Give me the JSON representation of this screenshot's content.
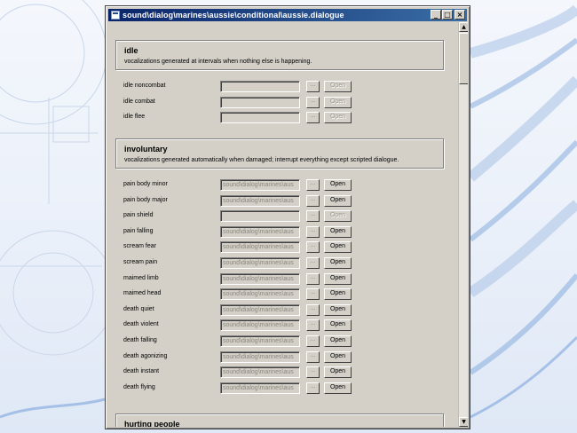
{
  "window": {
    "title": "sound\\dialog\\marines\\aussie\\conditional\\aussie.dialogue",
    "minimize_glyph": "_",
    "maximize_glyph": "□",
    "close_glyph": "×"
  },
  "icons": {
    "system": "window-app-icon",
    "browse": "ellipsis-icon",
    "scroll_up": "up-arrow-icon",
    "scroll_down": "down-arrow-icon"
  },
  "scrollbar": {
    "up_glyph": "▲",
    "down_glyph": "▼"
  },
  "browse_label": "...",
  "open_label": "Open",
  "sections": [
    {
      "title": "idle",
      "description": "vocalizations generated at intervals when nothing else is happening.",
      "rows": [
        {
          "label": "idle noncombat",
          "value": "",
          "open_enabled": false
        },
        {
          "label": "idle combat",
          "value": "",
          "open_enabled": false
        },
        {
          "label": "idle flee",
          "value": "",
          "open_enabled": false
        }
      ]
    },
    {
      "title": "involuntary",
      "description": "vocalizations generated automatically when damaged; interrupt everything except scripted dialogue.",
      "rows": [
        {
          "label": "pain body minor",
          "value": "sound\\dialog\\marines\\aus",
          "open_enabled": true
        },
        {
          "label": "pain body major",
          "value": "sound\\dialog\\marines\\aus",
          "open_enabled": true
        },
        {
          "label": "pain shield",
          "value": "",
          "open_enabled": false
        },
        {
          "label": "pain falling",
          "value": "sound\\dialog\\marines\\aus",
          "open_enabled": true
        },
        {
          "label": "scream fear",
          "value": "sound\\dialog\\marines\\aus",
          "open_enabled": true
        },
        {
          "label": "scream pain",
          "value": "sound\\dialog\\marines\\aus",
          "open_enabled": true
        },
        {
          "label": "maimed limb",
          "value": "sound\\dialog\\marines\\aus",
          "open_enabled": true
        },
        {
          "label": "maimed head",
          "value": "sound\\dialog\\marines\\aus",
          "open_enabled": true
        },
        {
          "label": "death quiet",
          "value": "sound\\dialog\\marines\\aus",
          "open_enabled": true
        },
        {
          "label": "death violent",
          "value": "sound\\dialog\\marines\\aus",
          "open_enabled": true
        },
        {
          "label": "death falling",
          "value": "sound\\dialog\\marines\\aus",
          "open_enabled": true
        },
        {
          "label": "death agonizing",
          "value": "sound\\dialog\\marines\\aus",
          "open_enabled": true
        },
        {
          "label": "death instant",
          "value": "sound\\dialog\\marines\\aus",
          "open_enabled": true
        },
        {
          "label": "death flying",
          "value": "sound\\dialog\\marines\\aus",
          "open_enabled": true
        }
      ]
    },
    {
      "title": "hurting people",
      "description": "",
      "rows": []
    }
  ]
}
